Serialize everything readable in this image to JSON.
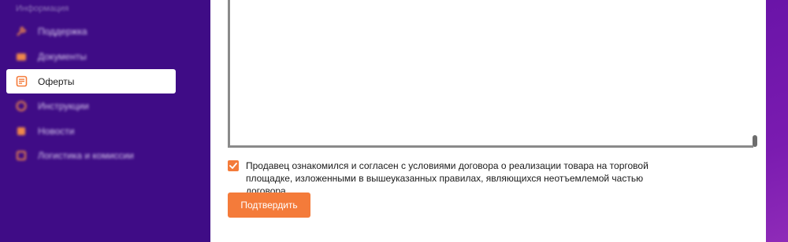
{
  "sidebar": {
    "section_label": "Информация",
    "items": [
      {
        "label": "Поддержка",
        "icon": "wrench-icon"
      },
      {
        "label": "Документы",
        "icon": "folder-icon"
      },
      {
        "label": "Оферты",
        "icon": "document-icon",
        "active": true
      },
      {
        "label": "Инструкции",
        "icon": "book-icon"
      },
      {
        "label": "Новости",
        "icon": "news-icon"
      },
      {
        "label": "Логистика и комиссии",
        "icon": "box-icon"
      }
    ]
  },
  "offer": {
    "agree_checked": true,
    "agree_text": "Продавец ознакомился и согласен с условиями договора о реализации товара на торговой площадке, изложенными в вышеуказанных правилах, являющихся неотъемлемой частью договора.",
    "confirm_label": "Подтвердить"
  },
  "colors": {
    "sidebar_bg": "#3f0c86",
    "accent": "#f47b3a",
    "panel_bg": "#ffffff"
  }
}
